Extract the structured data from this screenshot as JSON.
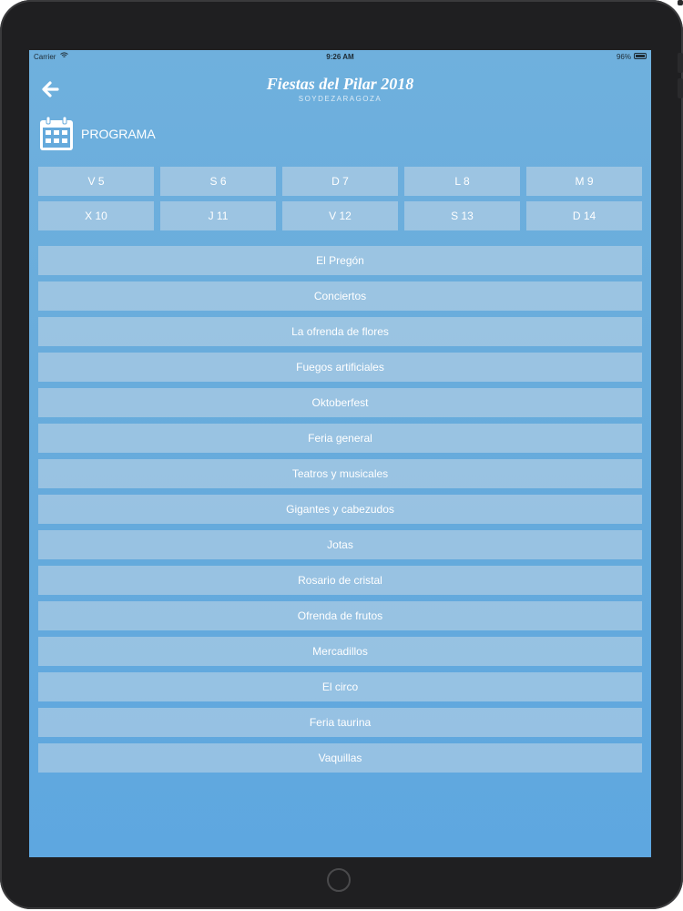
{
  "status_bar": {
    "carrier": "Carrier",
    "time": "9:26 AM",
    "battery": "96%"
  },
  "header": {
    "title": "Fiestas del Pilar 2018",
    "subtitle": "SOYDEZARAGOZA"
  },
  "section": {
    "label": "PROGRAMA"
  },
  "days": [
    {
      "label": "V 5"
    },
    {
      "label": "S 6"
    },
    {
      "label": "D 7"
    },
    {
      "label": "L 8"
    },
    {
      "label": "M 9"
    },
    {
      "label": "X 10"
    },
    {
      "label": "J 11"
    },
    {
      "label": "V 12"
    },
    {
      "label": "S 13"
    },
    {
      "label": "D 14"
    }
  ],
  "events": [
    {
      "label": "El Pregón"
    },
    {
      "label": "Conciertos"
    },
    {
      "label": "La ofrenda de flores"
    },
    {
      "label": "Fuegos artificiales"
    },
    {
      "label": "Oktoberfest"
    },
    {
      "label": "Feria general"
    },
    {
      "label": "Teatros y musicales"
    },
    {
      "label": "Gigantes y cabezudos"
    },
    {
      "label": "Jotas"
    },
    {
      "label": "Rosario de cristal"
    },
    {
      "label": "Ofrenda de frutos"
    },
    {
      "label": "Mercadillos"
    },
    {
      "label": "El circo"
    },
    {
      "label": "Feria taurina"
    },
    {
      "label": "Vaquillas"
    }
  ],
  "icons": {
    "back": "arrow-left-icon",
    "calendar": "calendar-icon",
    "wifi": "wifi-icon",
    "battery": "battery-icon"
  },
  "colors": {
    "screen_background": "#65aadc",
    "button_background": "#d7dfe8",
    "text": "#ffffff",
    "device_frame": "#1f1f21"
  }
}
